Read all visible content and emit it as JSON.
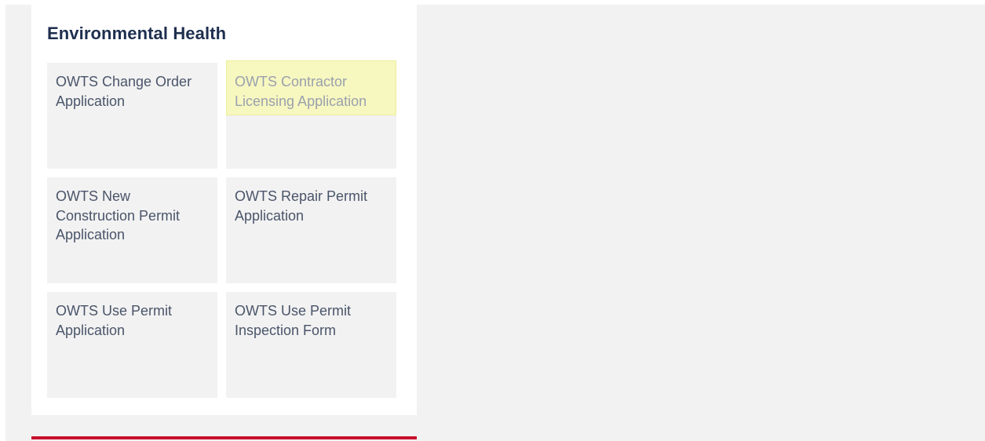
{
  "section": {
    "title": "Environmental Health"
  },
  "tiles": [
    {
      "label": "OWTS Change Order Application"
    },
    {
      "label": "OWTS Contractor Licensing Application"
    },
    {
      "label": "OWTS New Construction Permit Application"
    },
    {
      "label": "OWTS Repair Permit Application"
    },
    {
      "label": "OWTS Use Permit Application"
    },
    {
      "label": "OWTS Use Permit Inspection Form"
    }
  ],
  "colors": {
    "title": "#1e2f4f",
    "tile_background": "#f2f2f2",
    "highlight": "#f7f7c0",
    "accent_rule": "#c8102e"
  }
}
